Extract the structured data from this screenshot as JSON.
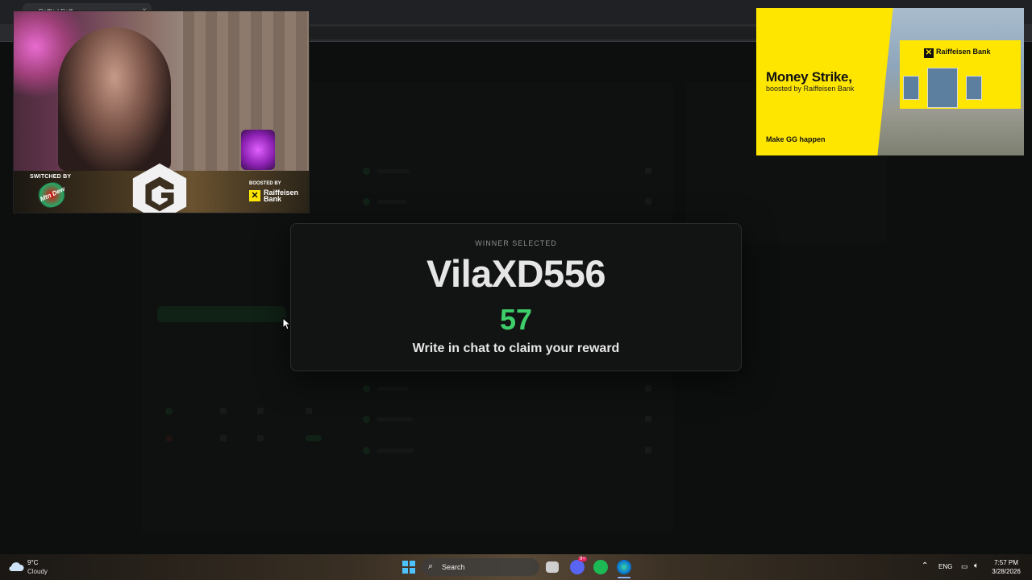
{
  "browser": {
    "tab_title": "Raffle | Raff"
  },
  "overlay": {
    "switched_by": "SWITCHED BY",
    "dew_brand": "Mtn Dew",
    "boosted_by": "BOOSTED BY",
    "rb_name": "Raiffeisen Bank"
  },
  "ad": {
    "title": "Money Strike,",
    "subtitle": "boosted by Raiffeisen Bank",
    "cta": "Make GG happen",
    "building_sign": "Raiffeisen Bank"
  },
  "modal": {
    "eyebrow": "WINNER SELECTED",
    "winner_name": "VilaXD556",
    "winner_number": "57",
    "claim_text": "Write in chat to claim your reward"
  },
  "taskbar": {
    "weather_temp": "9°C",
    "weather_desc": "Cloudy",
    "search_label": "Search",
    "discord_badge": "9+",
    "lang": "ENG",
    "time": "7:57 PM",
    "date": "3/28/2026"
  },
  "colors": {
    "accent_green": "#3ecf6a",
    "rb_yellow": "#ffe600",
    "windows_blue": "#4cc2ff"
  }
}
